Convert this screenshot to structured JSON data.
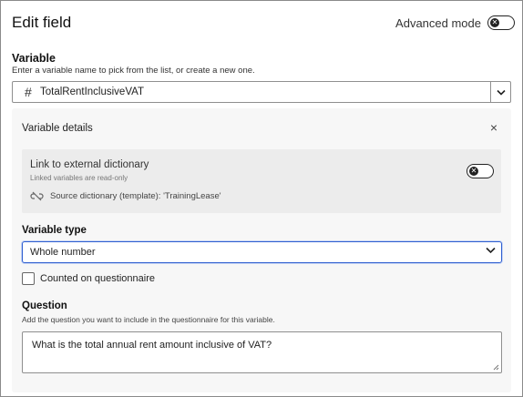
{
  "header": {
    "title": "Edit field",
    "advanced_mode_label": "Advanced mode",
    "advanced_mode_on": false
  },
  "variable": {
    "label": "Variable",
    "help": "Enter a variable name to pick from the list, or create a new one.",
    "value": "TotalRentInclusiveVAT",
    "type_icon": "#"
  },
  "details": {
    "title": "Variable details",
    "close_label": "×",
    "link": {
      "title": "Link to external dictionary",
      "subtitle": "Linked variables are read-only",
      "source": "Source dictionary (template): 'TrainingLease'",
      "toggle_on": false
    },
    "type": {
      "label": "Variable type",
      "value": "Whole number"
    },
    "counted": {
      "label": "Counted on questionnaire",
      "checked": false
    },
    "question": {
      "label": "Question",
      "help": "Add the question you want to include in the questionnaire for this variable.",
      "value": "What is the total annual rent amount inclusive of VAT?"
    }
  },
  "colors": {
    "focus": "#2f5fd0",
    "panel": "#f7f7f7",
    "link_box": "#ececec"
  }
}
